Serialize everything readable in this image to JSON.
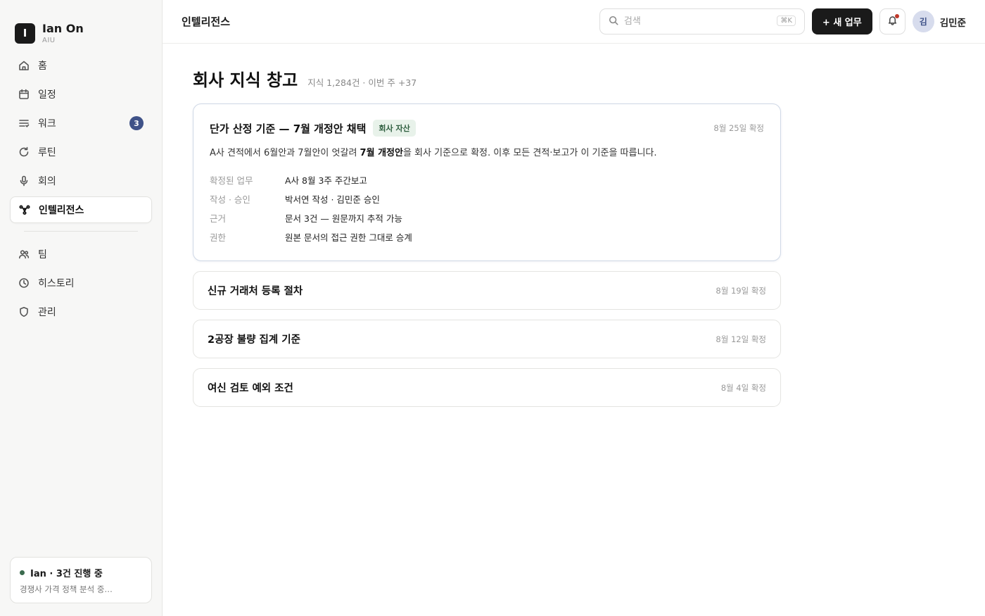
{
  "brand": {
    "logo_letter": "I",
    "name": "Ian On",
    "sub": "AIU"
  },
  "nav": {
    "items": [
      {
        "label": "홈",
        "icon": "home-icon"
      },
      {
        "label": "일정",
        "icon": "calendar-icon"
      },
      {
        "label": "워크",
        "icon": "list-icon",
        "badge": "3"
      },
      {
        "label": "루틴",
        "icon": "refresh-icon"
      },
      {
        "label": "회의",
        "icon": "mic-icon"
      },
      {
        "label": "인텔리전스",
        "icon": "network-icon",
        "active": true
      }
    ],
    "secondary": [
      {
        "label": "팀",
        "icon": "users-icon"
      },
      {
        "label": "히스토리",
        "icon": "clock-icon"
      },
      {
        "label": "관리",
        "icon": "shield-icon"
      }
    ]
  },
  "agent": {
    "title": "Ian · 3건 진행 중",
    "sub": "경쟁사 가격 정책 분석 중…",
    "status_color": "#3b6b4e"
  },
  "topbar": {
    "title": "인텔리전스",
    "search_placeholder": "검색",
    "search_shortcut": "⌘K",
    "new_button": "+ 새 업무",
    "user_initial": "김",
    "user_name": "김민준"
  },
  "page": {
    "title": "회사 지식 창고",
    "meta": "지식 1,284건 · 이번 주 +37"
  },
  "featured": {
    "title": "단가 산정 기준 — 7월 개정안 채택",
    "tag": "회사 자산",
    "date": "8월 25일 확정",
    "desc_pre": "A사 견적에서 6월안과 7월안이 엇갈려 ",
    "desc_bold": "7월 개정안",
    "desc_post": "을 회사 기준으로 확정. 이후 모든 견적·보고가 이 기준을 따릅니다.",
    "details": [
      {
        "key": "확정된 업무",
        "value": "A사 8월 3주 주간보고"
      },
      {
        "key": "작성 · 승인",
        "value": "박서연 작성 · 김민준 승인"
      },
      {
        "key": "근거",
        "value": "문서 3건 — 원문까지 추적 가능"
      },
      {
        "key": "권한",
        "value": "원본 문서의 접근 권한 그대로 승계"
      }
    ]
  },
  "knowledge": [
    {
      "title": "신규 거래처 등록 절차",
      "date": "8월 19일 확정"
    },
    {
      "title": "2공장 불량 집계 기준",
      "date": "8월 12일 확정"
    },
    {
      "title": "여신 검토 예외 조건",
      "date": "8월 4일 확정"
    }
  ],
  "colors": {
    "accent": "#3f5288",
    "dark": "#1a1a1a",
    "tag_bg": "#e8f2ea",
    "notification": "#c0392b"
  }
}
